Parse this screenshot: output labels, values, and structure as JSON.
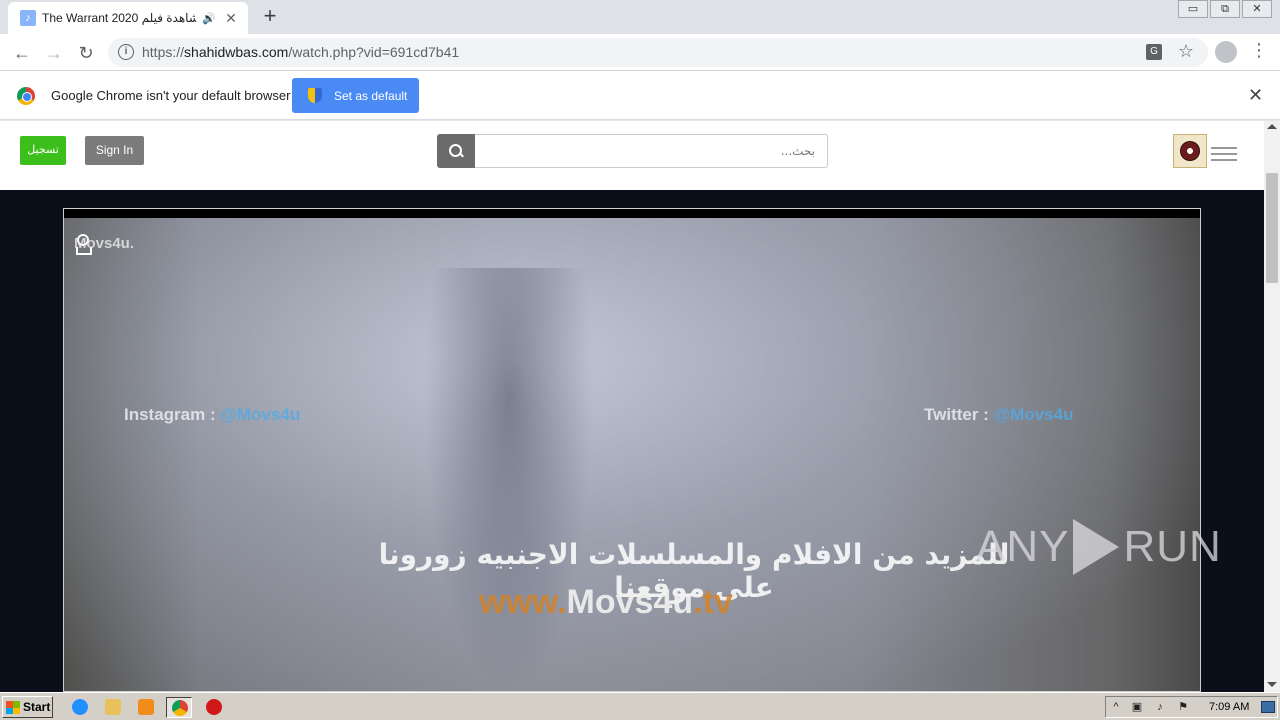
{
  "browser": {
    "tab": {
      "title": "The Warrant 2020 مشاهدة فيلم",
      "audio_glyph": "🔊",
      "close_glyph": "✕"
    },
    "new_tab_glyph": "+",
    "window_controls": [
      "▭",
      "⧉",
      "✕"
    ],
    "nav": {
      "back": "←",
      "forward": "→",
      "reload": "↻",
      "info": "i",
      "star": "☆",
      "menu": "⋮",
      "translate": "G"
    },
    "url": {
      "scheme": "https://",
      "host": "shahidwbas.com",
      "path": "/watch.php?vid=691cd7b41"
    }
  },
  "infobar": {
    "message": "Google Chrome isn't your default browser",
    "button_label": "Set as default",
    "close_glyph": "✕"
  },
  "site": {
    "register_label": "تسجيل",
    "signin_label": "Sign In",
    "search_placeholder": "بحث..."
  },
  "video": {
    "watermark_small": "Movs4u.",
    "instagram_label": "Instagram :",
    "instagram_handle": "@Movs4u",
    "twitter_label": "Twitter :",
    "twitter_handle": "@Movs4u",
    "arabic_line": "للمزيد من الافلام والمسلسلات الاجنبيه زورونا على موقعنا",
    "site_prefix": "www.",
    "site_name": "Movs4u",
    "site_suffix": ".tv"
  },
  "overlay": {
    "anyrun_left": "ANY",
    "anyrun_right": "RUN"
  },
  "taskbar": {
    "start_label": "Start",
    "clock": "7:09 AM",
    "tray_glyphs": [
      "^",
      "▣",
      "♪",
      "⚑"
    ]
  },
  "colors": {
    "register_green": "#3cbf1a",
    "signin_gray": "#7b7b7b",
    "default_button_blue": "#4a8af4",
    "page_background": "#0b0f1a"
  }
}
